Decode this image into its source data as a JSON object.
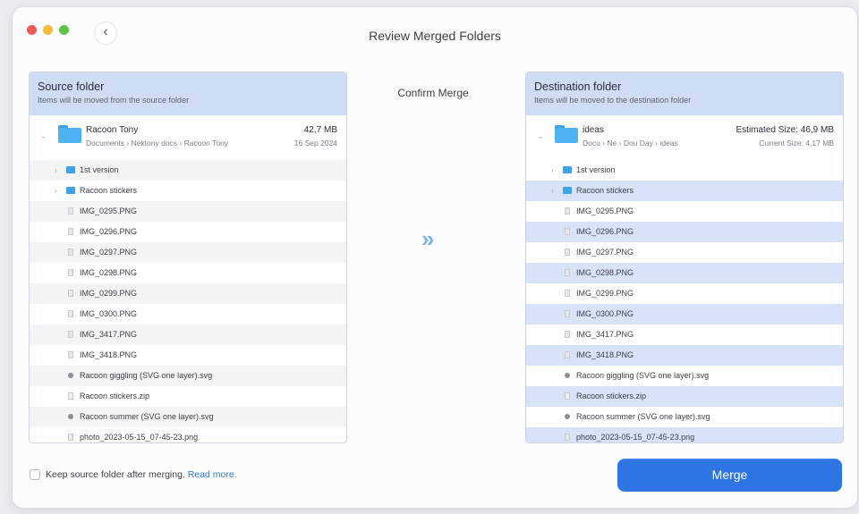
{
  "window": {
    "title": "Review Merged Folders",
    "back_glyph": "‹"
  },
  "source": {
    "title": "Source folder",
    "subtitle": "Items will be moved from the source folder",
    "root": {
      "name": "Racoon Tony",
      "path": "Documents › Nektony docs › Racoon Tony",
      "size": "42,7 MB",
      "date": "16 Sep 2024"
    },
    "items": [
      {
        "type": "folder",
        "name": "1st version"
      },
      {
        "type": "folder",
        "name": "Racoon stickers"
      },
      {
        "type": "file",
        "name": "IMG_0295.PNG"
      },
      {
        "type": "file",
        "name": "IMG_0296.PNG"
      },
      {
        "type": "file",
        "name": "IMG_0297.PNG"
      },
      {
        "type": "file",
        "name": "IMG_0298.PNG"
      },
      {
        "type": "file",
        "name": "IMG_0299.PNG"
      },
      {
        "type": "file",
        "name": "IMG_0300.PNG"
      },
      {
        "type": "file",
        "name": "IMG_3417.PNG"
      },
      {
        "type": "file",
        "name": "IMG_3418.PNG"
      },
      {
        "type": "svg",
        "name": "Racoon giggling (SVG one layer).svg"
      },
      {
        "type": "zip",
        "name": "Racoon stickers.zip"
      },
      {
        "type": "svg",
        "name": "Racoon summer (SVG one layer).svg"
      },
      {
        "type": "file",
        "name": "photo_2023-05-15_07-45-23.png"
      }
    ]
  },
  "destination": {
    "title": "Destination folder",
    "subtitle": "Items will be moved to the destination folder",
    "root": {
      "name": "ideas",
      "path": "Docu › Ne › Dou Day › ideas",
      "estimated_size": "Estimated Size: 46,9 MB",
      "current_size": "Current Size: 4,17 MB"
    },
    "items": [
      {
        "type": "folder",
        "name": "1st version"
      },
      {
        "type": "folder",
        "name": "Racoon stickers"
      },
      {
        "type": "file",
        "name": "IMG_0295.PNG"
      },
      {
        "type": "file",
        "name": "IMG_0296.PNG"
      },
      {
        "type": "file",
        "name": "IMG_0297.PNG"
      },
      {
        "type": "file",
        "name": "IMG_0298.PNG"
      },
      {
        "type": "file",
        "name": "IMG_0299.PNG"
      },
      {
        "type": "file",
        "name": "IMG_0300.PNG"
      },
      {
        "type": "file",
        "name": "IMG_3417.PNG"
      },
      {
        "type": "file",
        "name": "IMG_3418.PNG"
      },
      {
        "type": "svg",
        "name": "Racoon giggling (SVG one layer).svg"
      },
      {
        "type": "zip",
        "name": "Racoon stickers.zip"
      },
      {
        "type": "svg",
        "name": "Racoon summer (SVG one layer).svg"
      },
      {
        "type": "file",
        "name": "photo_2023-05-15_07-45-23.png"
      }
    ]
  },
  "center": {
    "confirm_label": "Confirm Merge",
    "arrow_glyph": "»"
  },
  "footer": {
    "keep_label": "Keep source folder after merging.",
    "read_more": "Read more.",
    "keep_checked": false,
    "merge_label": "Merge"
  },
  "colors": {
    "accent": "#2e74e2",
    "panel_header": "#cfdcf6",
    "folder": "#4db2f0",
    "link": "#2a77dd"
  }
}
